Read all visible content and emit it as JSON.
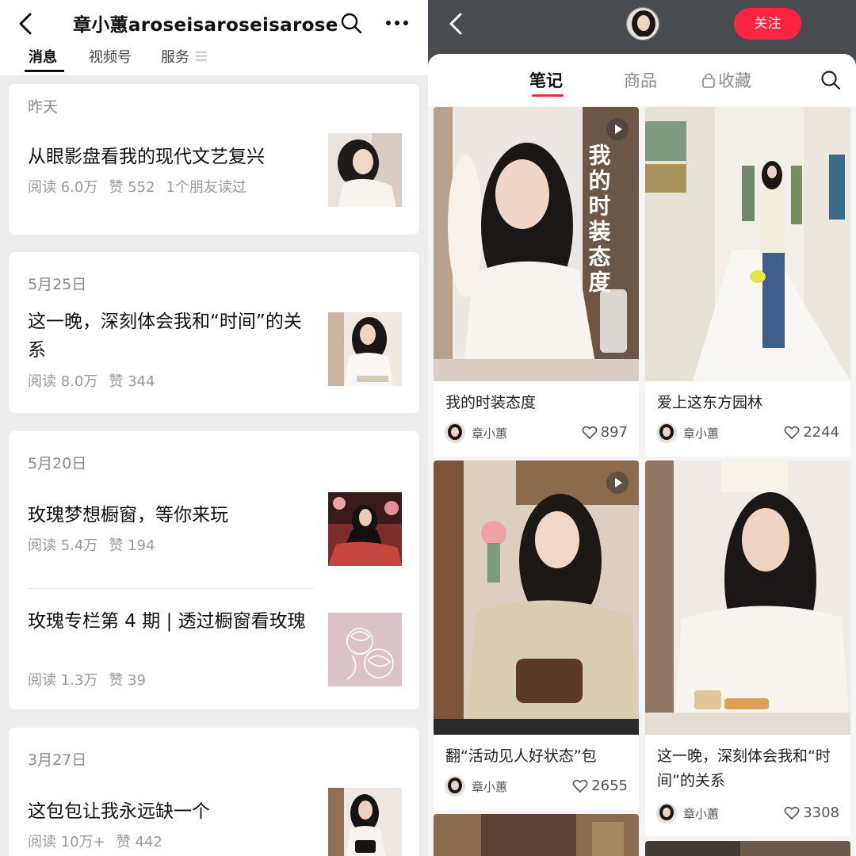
{
  "left": {
    "title": "章小蕙aroseisaroseisarose",
    "tabs": [
      "消息",
      "视频号",
      "服务"
    ],
    "groups": [
      {
        "date": "昨天",
        "articles": [
          {
            "title": "从眼影盘看我的现代文艺复兴",
            "reads": "阅读 6.0万",
            "likes": "赞 552",
            "extra": "1个朋友读过"
          }
        ]
      },
      {
        "date": "5月25日",
        "articles": [
          {
            "title": "这一晚，深刻体会我和“时间”的关系",
            "reads": "阅读 8.0万",
            "likes": "赞 344",
            "extra": ""
          }
        ]
      },
      {
        "date": "5月20日",
        "articles": [
          {
            "title": "玫瑰梦想橱窗，等你来玩",
            "reads": "阅读 5.4万",
            "likes": "赞 194",
            "extra": ""
          },
          {
            "title": "玫瑰专栏第 4 期 | 透过橱窗看玫瑰",
            "reads": "阅读 1.3万",
            "likes": "赞 39",
            "extra": ""
          }
        ]
      },
      {
        "date": "3月27日",
        "articles": [
          {
            "title": "这包包让我永远缺一个",
            "reads": "阅读 10万+",
            "likes": "赞 442",
            "extra": ""
          }
        ]
      }
    ]
  },
  "right": {
    "follow_label": "关注",
    "tabs": [
      "笔记",
      "商品",
      "收藏"
    ],
    "notes": [
      {
        "title": "我的时装态度",
        "overlay": "我的时装态度",
        "author": "章小蕙",
        "likes": "897"
      },
      {
        "title": "爱上这东方园林",
        "author": "章小蕙",
        "likes": "2244"
      },
      {
        "title": "翻“活动见人好状态”包",
        "author": "章小蕙",
        "likes": "2655"
      },
      {
        "title": "这一晚，深刻体会我和“时间”的关系",
        "author": "章小蕙",
        "likes": "3308"
      }
    ],
    "colors": {
      "accent": "#ff2442",
      "header": "#4a4d4f"
    }
  }
}
